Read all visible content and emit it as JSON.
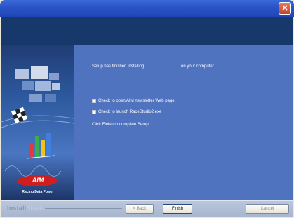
{
  "window": {
    "close_glyph": "×"
  },
  "main": {
    "finished_prefix": "Setup has finished installing",
    "finished_suffix": "on your computer.",
    "checkbox_newsletter_label": "Check to open AIM newsletter Web page",
    "checkbox_launch_label": "Check to launch RaceStudio2.exe",
    "finish_instruction": "Click Finish to complete Setup."
  },
  "side_panel": {
    "brand_logo": "AIM",
    "tagline": "Racing Data Power"
  },
  "footer": {
    "installshield_bold": "Install",
    "installshield_light": "Shield",
    "back_label": "< Back",
    "finish_label": "Finish",
    "cancel_label": "Cancel"
  },
  "colors": {
    "header_band": "#17386b",
    "main_panel": "#4f73bf",
    "brand_red": "#d01e1e"
  },
  "checkboxes": {
    "newsletter_checked": false,
    "launch_checked": false
  }
}
